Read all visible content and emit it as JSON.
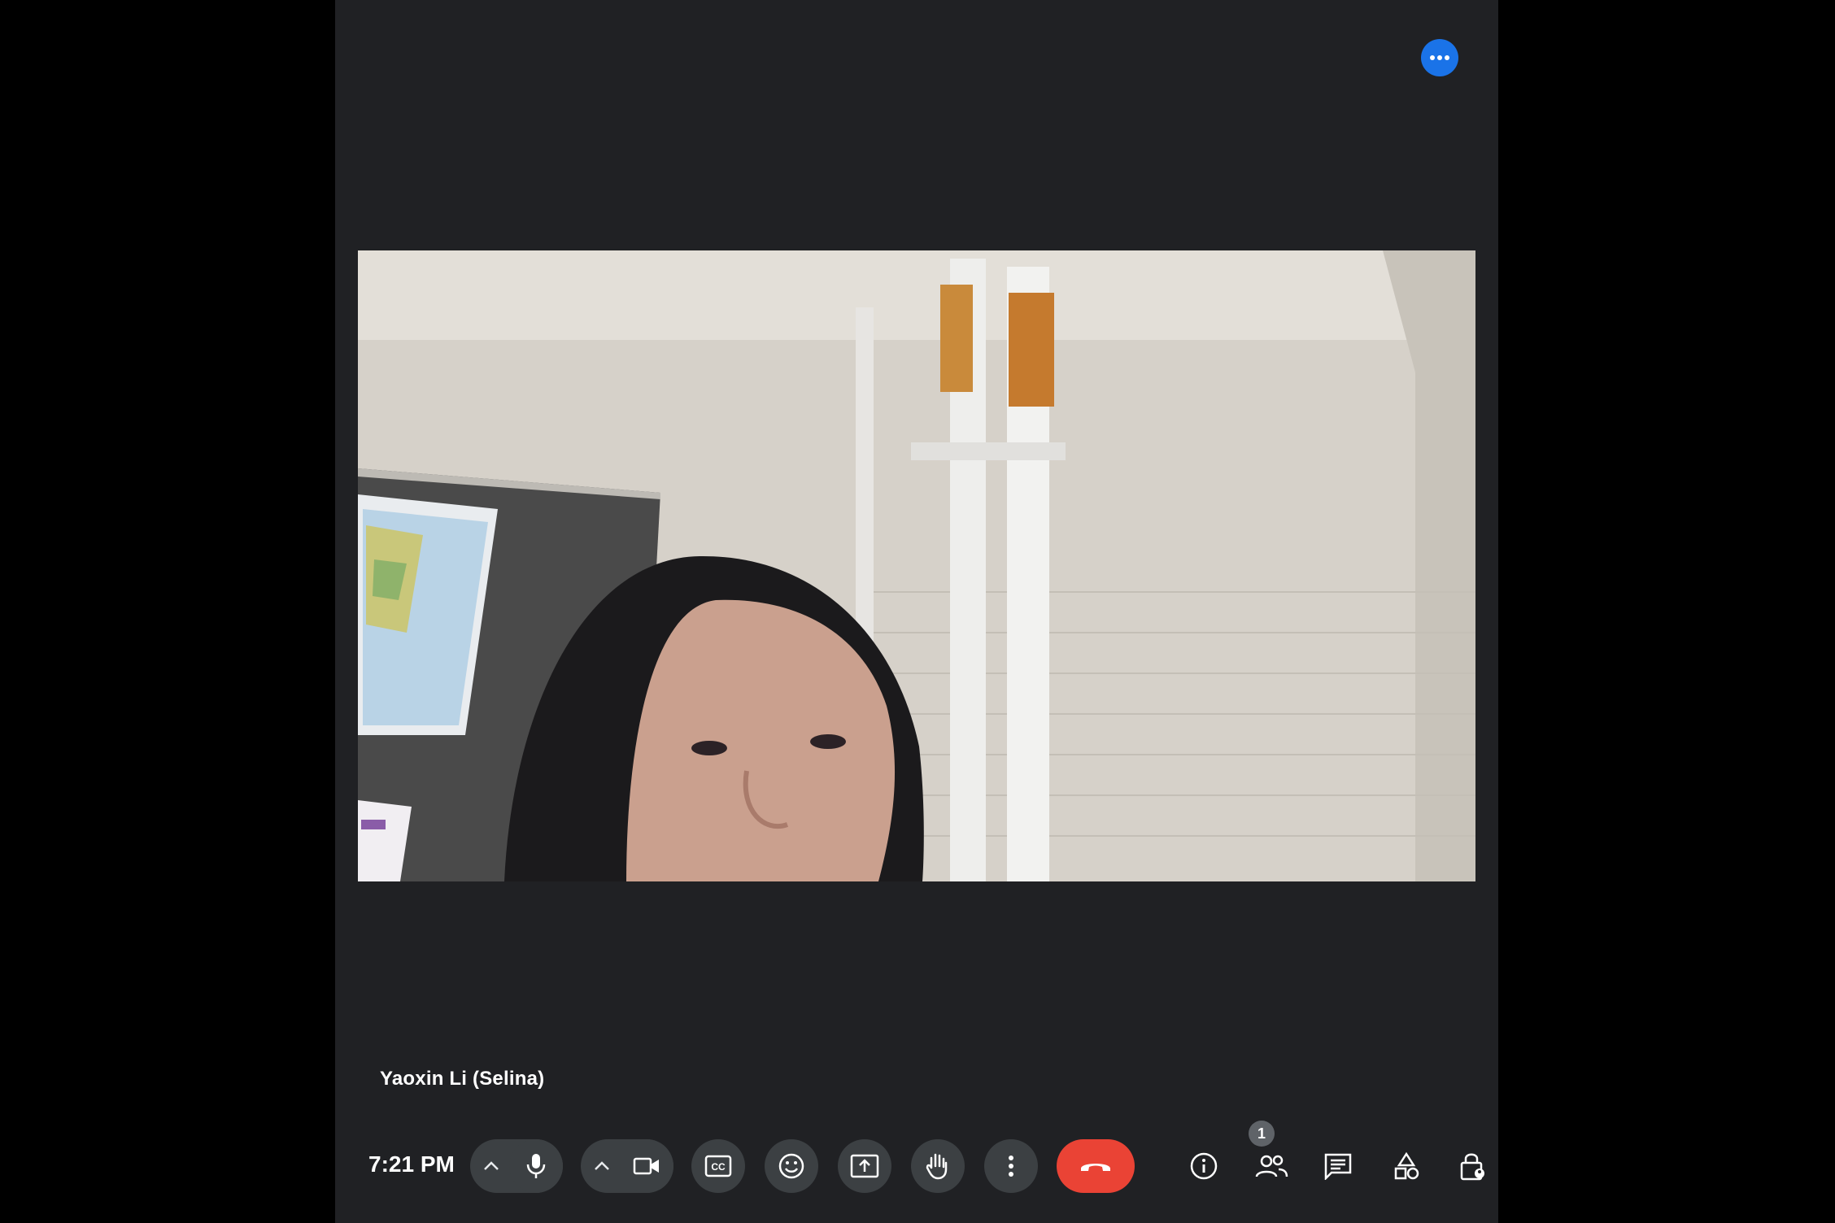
{
  "meeting": {
    "participant_name": "Yaoxin Li (Selina)",
    "time": "7:21 PM",
    "participants_count": "1"
  },
  "icons": {
    "more": "more-horiz-icon",
    "mic": "mic-icon",
    "camera": "videocam-icon",
    "captions": "closed-caption-icon",
    "reactions": "emoji-icon",
    "present": "present-screen-icon",
    "raise_hand": "hand-icon",
    "more_options": "more-vert-icon",
    "end_call": "call-end-icon",
    "info": "info-icon",
    "people": "people-icon",
    "chat": "chat-icon",
    "activities": "activities-icon",
    "host_controls": "lock-person-icon"
  },
  "colors": {
    "stage_bg": "#202124",
    "button_bg": "#3c4043",
    "end_call": "#ea4335",
    "accent_blue": "#1a73e8"
  }
}
